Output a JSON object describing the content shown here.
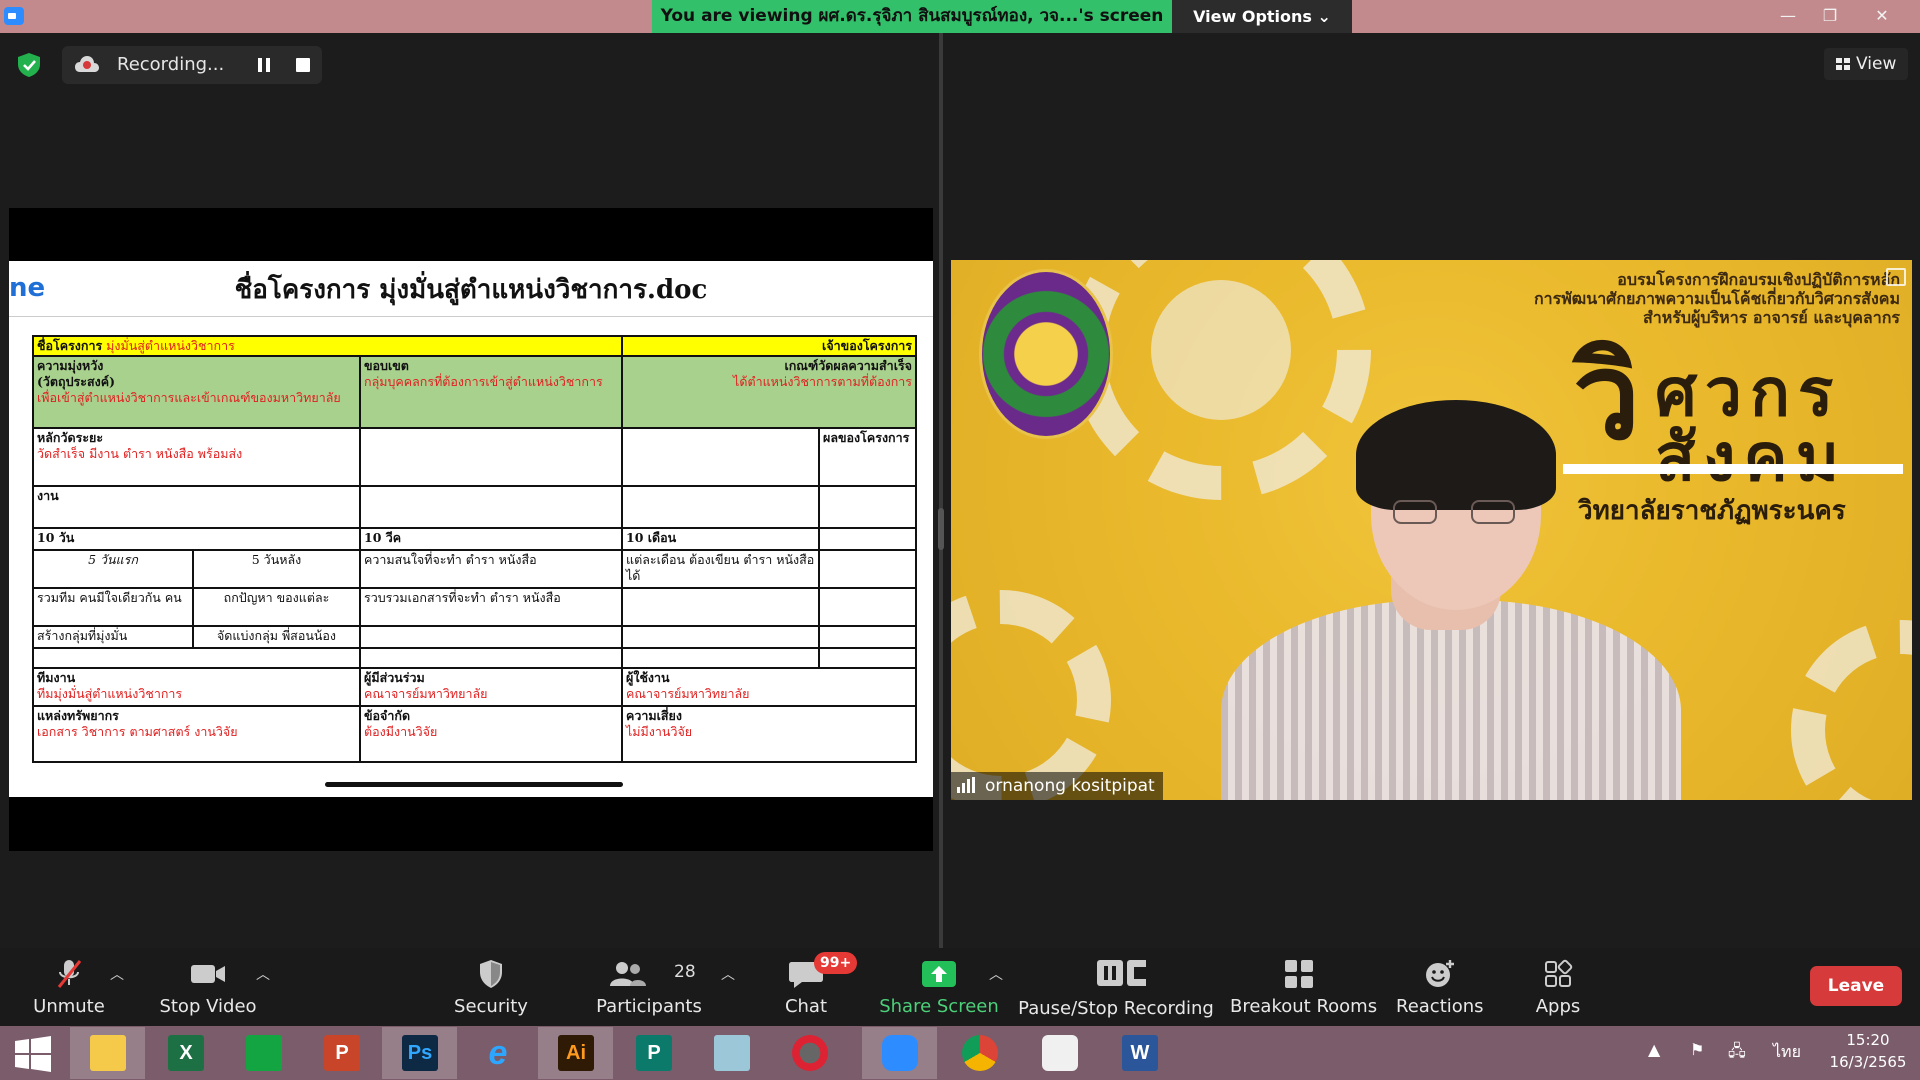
{
  "titlebar": {
    "viewing_banner": "You are viewing ผศ.ดร.รุจิภา สินสมบูรณ์ทอง, วจ...'s screen",
    "view_options": "View Options ⌄",
    "minimize": "—",
    "restore": "❐",
    "close": "✕"
  },
  "recording": {
    "label": "Recording..."
  },
  "view_button": {
    "label": "View"
  },
  "shared_doc": {
    "title": "ชื่อโครงการ มุ่งมั่นสู่ตำแหน่งวิชาการ.doc",
    "left_fragment": "ne",
    "table": {
      "r1_left_label": "ชื่อโครงการ",
      "r1_left_value": "มุ่งมั่นสู่ตำแหน่งวิชาการ",
      "r1_right": "เจ้าของโครงการ",
      "r2_c1_label": "ความมุ่งหวัง",
      "r2_c1_label2": "(วัตถุประสงค์)",
      "r2_c1_value": "เพื่อเข้าสู่ตำแหน่งวิชาการและเข้าเกณฑ์ของมหาวิทยาลัย",
      "r2_c2_label": "ขอบเขต",
      "r2_c2_value": "กลุ่มบุคคลกรที่ต้องการเข้าสู่ตำแหน่งวิชาการ",
      "r2_c3_label": "เกณฑ์วัดผลความสำเร็จ",
      "r2_c3_value": "ได้ตำแหน่งวิชาการตามที่ต้องการ",
      "r3_c1_label": "หลักวัดระยะ",
      "r3_c1_value": "วัดสำเร็จ มีงาน ตำรา หนังสือ พร้อมส่ง",
      "r3_c4": "ผลของโครงการ",
      "r4_c1": "งาน",
      "r5_c1": "10 วัน",
      "r5_c2": "10 วีค",
      "r5_c3": "10 เดือน",
      "r6_c1a": "5 วันแรก",
      "r6_c1b": "5 วันหลัง",
      "r6_c2": "ความสนใจที่จะทำ ตำรา หนังสือ",
      "r6_c3": "แต่ละเดือน ต้องเขียน ตำรา หนังสือ ได้",
      "r7_c1a": "รวมทีม คนมีใจเดียวกัน คน",
      "r7_c1b": "ถกปัญหา ของแต่ละ",
      "r7_c2": "รวบรวมเอกสารที่จะทำ ตำรา หนังสือ",
      "r8_c1a": "สร้างกลุ่มที่มุ่งมั่น",
      "r8_c1b": "จัดแบ่งกลุ่ม พี่สอนน้อง",
      "r10_c1_label": "ทีมงาน",
      "r10_c1_value": "ทีมมุ่งมั่นสู่ตำแหน่งวิชาการ",
      "r10_c2_label": "ผู้มีส่วนร่วม",
      "r10_c2_value": "คณาจารย์มหาวิทยาลัย",
      "r10_c3_label": "ผู้ใช้งาน",
      "r10_c3_value": "คณาจารย์มหาวิทยาลัย",
      "r11_c1_label": "แหล่งทรัพยากร",
      "r11_c1_value": "เอกสาร วิชาการ ตามศาสตร์ งานวิจัย",
      "r11_c2_label": "ข้อจำกัด",
      "r11_c2_value": "ต้องมีงานวิจัย",
      "r11_c3_label": "ความเสี่ยง",
      "r11_c3_value": "ไม่มีงานวิจัย"
    }
  },
  "video": {
    "participant_name": "ornanong kositpipat",
    "banner_line1": "อบรมโครงการฝึกอบรมเชิงปฏิบัติการหลัก",
    "banner_line2": "การพัฒนาศักยภาพความเป็นโค้ชเกี่ยวกับวิศวกรสังคม",
    "banner_line3": "สำหรับผู้บริหาร อาจารย์ และบุคลากร",
    "big_wi": "วิ",
    "big_line1": "ศวกร",
    "big_line2": "สังคม",
    "subtitle": "วิทยาลัยราชภัฏพระนคร"
  },
  "toolbar": {
    "unmute": "Unmute",
    "stop_video": "Stop Video",
    "security": "Security",
    "participants": "Participants",
    "participants_count": "28",
    "chat": "Chat",
    "chat_badge": "99+",
    "share_screen": "Share Screen",
    "pause_stop_recording": "Pause/Stop Recording",
    "breakout_rooms": "Breakout Rooms",
    "reactions": "Reactions",
    "apps": "Apps",
    "leave": "Leave"
  },
  "taskbar": {
    "apps": [
      "file-explorer",
      "excel",
      "project",
      "powerpoint",
      "photoshop",
      "internet-explorer",
      "illustrator",
      "publisher",
      "notepad",
      "photoscape",
      "zoom",
      "chrome",
      "paint",
      "word"
    ],
    "excel_letter": "X",
    "project_letter": "",
    "ppt_letter": "P",
    "ps_letter": "Ps",
    "ie_letter": "e",
    "ai_letter": "Ai",
    "pub_letter": "P",
    "word_letter": "W",
    "language": "ไทย",
    "time": "15:20",
    "date": "16/3/2565",
    "tray_up": "▲"
  },
  "colors": {
    "zoom_green": "#33c06a",
    "leave_red": "#d63a3a",
    "doc_yellow": "#ffff00",
    "doc_green": "#a9d18e",
    "doc_red_text": "#e02020",
    "taskbar": "#7a5c6a"
  }
}
